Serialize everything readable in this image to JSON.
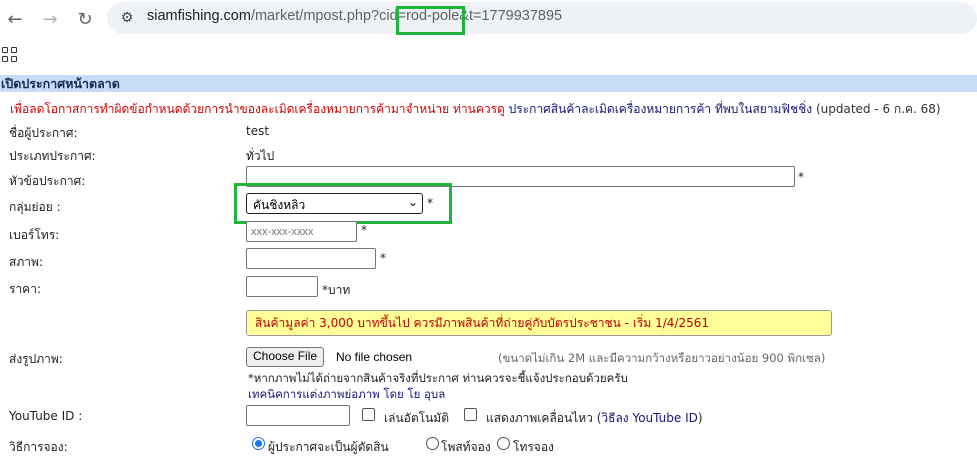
{
  "browser": {
    "url_host": "siamfishing.com",
    "url_path": "/market/mpost.php?cid=rod-pole&t=1779937895"
  },
  "section": {
    "title": "เปิดประกาศหน้าตลาด"
  },
  "notice": {
    "warning": "เพื่อลดโอกาสการทำผิดข้อกำหนดด้วยการนำของละเมิดเครื่องหมายการค้ามาจำหน่าย ท่านควรดู",
    "link": "ประกาศสินค้าละเมิดเครื่องหมายการค้า ที่พบในสยามฟิชชิ่ง",
    "updated": "(updated - 6 ก.ค. 68)"
  },
  "form": {
    "poster_label": "ชื่อผู้ประกาศ:",
    "poster_value": "test",
    "type_label": "ประเภทประกาศ:",
    "type_value": "ทั่วไป",
    "title_label": "หัวข้อประกาศ:",
    "subgroup_label": "กลุ่มย่อย :",
    "subgroup_value": "คันชิงหลิว",
    "phone_label": "เบอร์โทร:",
    "phone_placeholder": "xxx-xxx-xxxx",
    "condition_label": "สภาพ:",
    "price_label": "ราคา:",
    "price_unit": "*บาท",
    "required_mark": "*",
    "warning_box": "สินค้ามูลค่า 3,000 บาทขึ้นไป ควรมีภาพสินค้าที่ถ่ายคู่กับบัตรประชาชน - เริ่ม 1/4/2561",
    "image_label": "ส่งรูปภาพ:",
    "choose_file": "Choose File",
    "no_file": "No file chosen",
    "image_hint": "(ขนาดไม่เกิน 2M และมีความกว้างหรือยาวอย่างน้อย 900 พิกเซล)",
    "image_note": "*หากภาพไม่ได้ถ่ายจากสินค้าจริงที่ประกาศ ท่านควรจะชี้แจ้งประกอบด้วยครับ",
    "image_tip_link": "เทคนิคการแต่งภาพย่อภาพ โดย โย อุบล",
    "youtube_label": "YouTube ID :",
    "autoplay_label": "เล่นอัตโนมัติ",
    "show_motion_label": "แสดงภาพเคลื่อนไหว",
    "youtube_help_open": "(",
    "youtube_help_link": "วิธีลง YouTube ID",
    "youtube_help_close": ")",
    "booking_label": "วิธีการจอง:",
    "booking_options": [
      "ผู้ประกาศจะเป็นผู้ตัดสิน",
      "โพสท์จอง",
      "โทรจอง"
    ],
    "booking_selected": 0
  },
  "colors": {
    "highlight": "#1fb53a",
    "section_bg": "#c7dcf6",
    "warning_bg": "#ffff99"
  }
}
